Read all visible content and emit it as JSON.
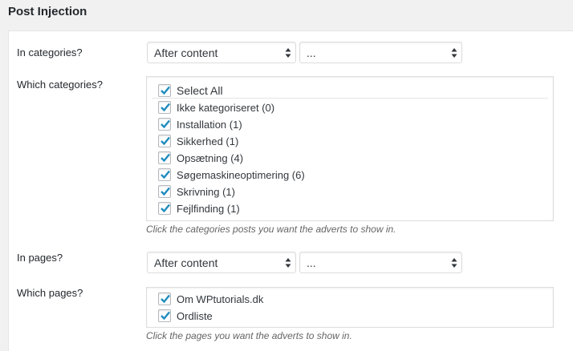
{
  "section": {
    "title": "Post Injection"
  },
  "categories_row": {
    "label": "In categories?",
    "position_select": "After content",
    "second_select": "..."
  },
  "which_categories": {
    "label": "Which categories?",
    "select_all": "Select All",
    "items": [
      "Ikke kategoriseret (0)",
      "Installation (1)",
      "Sikkerhed (1)",
      "Opsætning (4)",
      "Søgemaskineoptimering (6)",
      "Skrivning (1)",
      "Fejlfinding (1)"
    ],
    "hint": "Click the categories posts you want the adverts to show in."
  },
  "pages_row": {
    "label": "In pages?",
    "position_select": "After content",
    "second_select": "..."
  },
  "which_pages": {
    "label": "Which pages?",
    "items": [
      "Om WPtutorials.dk",
      "Ordliste"
    ],
    "hint": "Click the pages you want the adverts to show in."
  },
  "colors": {
    "check": "#1e8cbe",
    "title": "#23282d",
    "panel_bg": "#ffffff",
    "page_bg": "#f1f1f1"
  }
}
